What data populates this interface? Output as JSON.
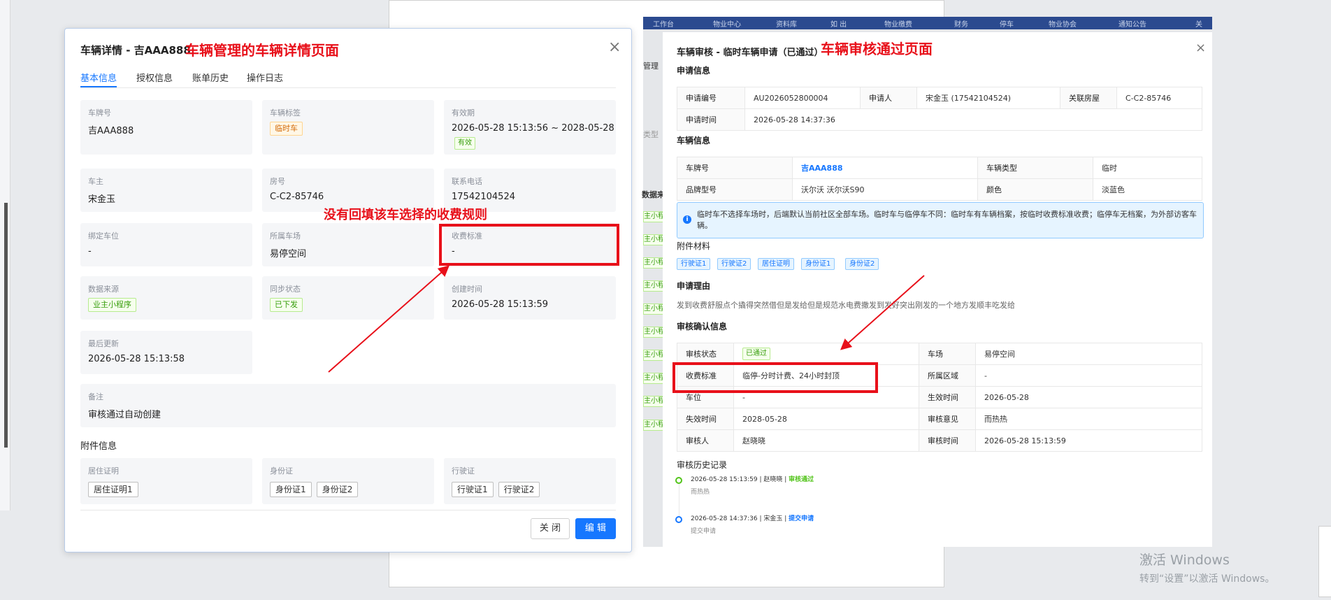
{
  "left_modal": {
    "title": "车辆详情 - 吉AAA888",
    "annotation": "车辆管理的车辆详情页面",
    "missing_annotation": "没有回填该车选择的收费规则",
    "tabs": [
      "基本信息",
      "授权信息",
      "账单历史",
      "操作日志"
    ],
    "fields": {
      "plate": {
        "label": "车牌号",
        "value": "吉AAA888"
      },
      "vehicle_tag": {
        "label": "车辆标签",
        "value": "临时车"
      },
      "validity": {
        "label": "有效期",
        "value": "2026-05-28 15:13:56 ~ 2028-05-28",
        "status": "有效"
      },
      "owner": {
        "label": "车主",
        "value": "宋金玉"
      },
      "room": {
        "label": "房号",
        "value": "C-C2-85746"
      },
      "phone": {
        "label": "联系电话",
        "value": "17542104524"
      },
      "bound_space": {
        "label": "绑定车位",
        "value": "-"
      },
      "parking_lot": {
        "label": "所属车场",
        "value": "易停空间"
      },
      "fee_standard": {
        "label": "收费标准",
        "value": "-"
      },
      "data_source": {
        "label": "数据来源",
        "value": "业主小程序"
      },
      "sync_status": {
        "label": "同步状态",
        "value": "已下发"
      },
      "created": {
        "label": "创建时间",
        "value": "2026-05-28 15:13:59"
      },
      "updated": {
        "label": "最后更新",
        "value": "2026-05-28 15:13:58"
      },
      "remark": {
        "label": "备注",
        "value": "审核通过自动创建"
      }
    },
    "attachments_title": "附件信息",
    "attachments": {
      "residence": {
        "label": "居住证明",
        "items": [
          "居住证明1"
        ]
      },
      "id_card": {
        "label": "身份证",
        "items": [
          "身份证1",
          "身份证2"
        ]
      },
      "driving": {
        "label": "行驶证",
        "items": [
          "行驶证1",
          "行驶证2"
        ]
      }
    },
    "buttons": {
      "close": "关 闭",
      "edit": "编 辑"
    }
  },
  "right_modal": {
    "title": "车辆审核 - 临时车辆申请（已通过）",
    "annotation": "车辆审核通过页面",
    "bg_topbar": [
      "工作台",
      "物业中心",
      "资料库",
      "如 出",
      "物业缴费",
      "财务",
      "停车",
      "物业协会",
      "通知公告",
      "关"
    ],
    "bg_side": {
      "manage": "管理",
      "type": "类型",
      "source": "数据来",
      "green_tag": "主小程"
    },
    "apply_section": "申请信息",
    "apply": {
      "no_label": "申请编号",
      "no": "AU2026052800004",
      "applicant_label": "申请人",
      "applicant": "宋金玉 (17542104524)",
      "house_label": "关联房屋",
      "house": "C-C2-85746",
      "time_label": "申请时间",
      "time": "2026-05-28 14:37:36"
    },
    "vehicle_section": "车辆信息",
    "vehicle": {
      "plate_label": "车牌号",
      "plate": "吉AAA888",
      "type_label": "车辆类型",
      "type": "临时",
      "brand_label": "品牌型号",
      "brand": "沃尔沃 沃尔沃S90",
      "color_label": "颜色",
      "color": "淡蓝色"
    },
    "alert_text": "临时车不选择车场时，后端默认当前社区全部车场。临时车与临停车不同：临时车有车辆档案，按临时收费标准收费；临停车无档案，为外部访客车辆。",
    "materials_section": "附件材料",
    "materials": [
      "行驶证1",
      "行驶证2",
      "居住证明",
      "身份证1",
      "身份证2"
    ],
    "reason_section": "申请理由",
    "reason": "发到收费舒服点个撬得突然借但是发给但是规范水电费撒发到发好突出刚发的一个地方发顺丰吃发给",
    "audit_section": "审核确认信息",
    "audit": {
      "status_label": "审核状态",
      "status": "已通过",
      "lot_label": "车场",
      "lot": "易停空间",
      "fee_label": "收费标准",
      "fee": "临停-分时计费、24小时封顶",
      "area_label": "所属区域",
      "area": "-",
      "space_label": "车位",
      "space": "-",
      "effective_label": "生效时间",
      "effective": "2026-05-28",
      "expire_label": "失效时间",
      "expire": "2028-05-28",
      "opinion_label": "审核意见",
      "opinion": "而热热",
      "auditor_label": "审核人",
      "auditor": "赵晓晓",
      "audit_time_label": "审核时间",
      "audit_time": "2026-05-28 15:13:59"
    },
    "history_section": "审核历史记录",
    "history": [
      {
        "meta": "2026-05-28 15:13:59 | 赵晓晓 | ",
        "action": "审核通过",
        "note": "而热热"
      },
      {
        "meta": "2026-05-28 14:37:36 | 宋金玉 | ",
        "action": "提交申请",
        "note": "提交申请"
      }
    ]
  },
  "watermark": {
    "line1": "激活 Windows",
    "line2": "转到“设置”以激活 Windows。"
  },
  "colors": {
    "primary": "#1677ff",
    "annotation_red": "#e8101a",
    "success": "#389e0d",
    "warning": "#d46b08"
  }
}
